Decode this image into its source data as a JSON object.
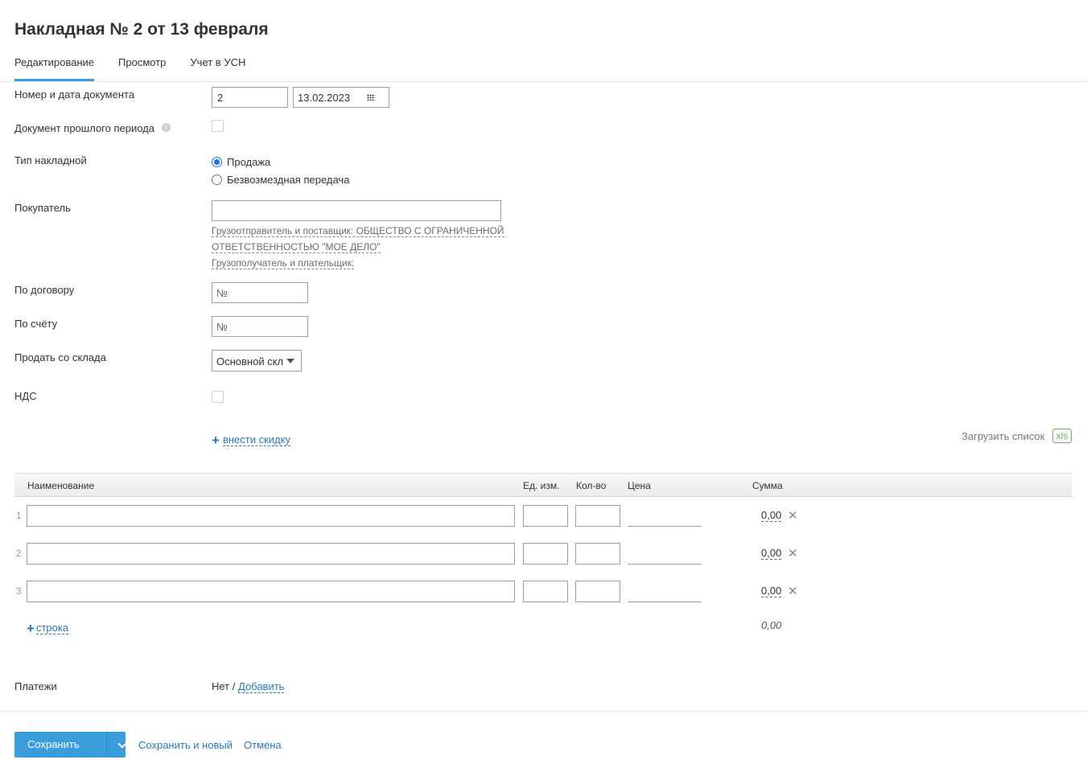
{
  "page": {
    "title": "Накладная № 2 от 13 февраля"
  },
  "tabs": [
    {
      "label": "Редактирование",
      "active": true
    },
    {
      "label": "Просмотр",
      "active": false
    },
    {
      "label": "Учет в УСН",
      "active": false
    }
  ],
  "form": {
    "doc_number_label": "Номер и дата документа",
    "doc_number_value": "2",
    "doc_date_value": "13.02.2023",
    "past_period_label": "Документ прошлого периода",
    "past_period_checked": false,
    "invoice_type_label": "Тип накладной",
    "invoice_type_options": [
      {
        "label": "Продажа",
        "checked": true
      },
      {
        "label": "Безвозмездная передача",
        "checked": false
      }
    ],
    "buyer_label": "Покупатель",
    "buyer_value": "",
    "shipper_line1": "Грузоотправитель и поставщик: ОБЩЕСТВО С ОГРАНИЧЕННОЙ",
    "shipper_line2": "ОТВЕТСТВЕННОСТЬЮ \"МОЕ ДЕЛО\"",
    "consignee_text": "Грузополучатель и плательщик:",
    "contract_label": "По договору",
    "contract_placeholder": "№",
    "bill_label": "По счёту",
    "bill_placeholder": "№",
    "warehouse_label": "Продать со склада",
    "warehouse_value": "Основной скл",
    "vat_label": "НДС",
    "vat_checked": false,
    "discount_link": "внести скидку",
    "upload_list_label": "Загрузить список",
    "upload_badge": "xls"
  },
  "table": {
    "headers": {
      "name": "Наименование",
      "unit": "Ед. изм.",
      "qty": "Кол-во",
      "price": "Цена",
      "sum": "Сумма"
    },
    "rows": [
      {
        "num": "1",
        "sum": "0,00"
      },
      {
        "num": "2",
        "sum": "0,00"
      },
      {
        "num": "3",
        "sum": "0,00"
      }
    ],
    "add_row_link": "строка",
    "total": "0,00"
  },
  "payments": {
    "label": "Платежи",
    "none_text": "Нет /",
    "add_link": "Добавить"
  },
  "footer": {
    "save_label": "Сохранить",
    "save_new_label": "Сохранить и новый",
    "cancel_label": "Отмена"
  },
  "colors": {
    "accent": "#3b9ddb",
    "link": "#2879c0",
    "xls_green": "#66b65a"
  }
}
